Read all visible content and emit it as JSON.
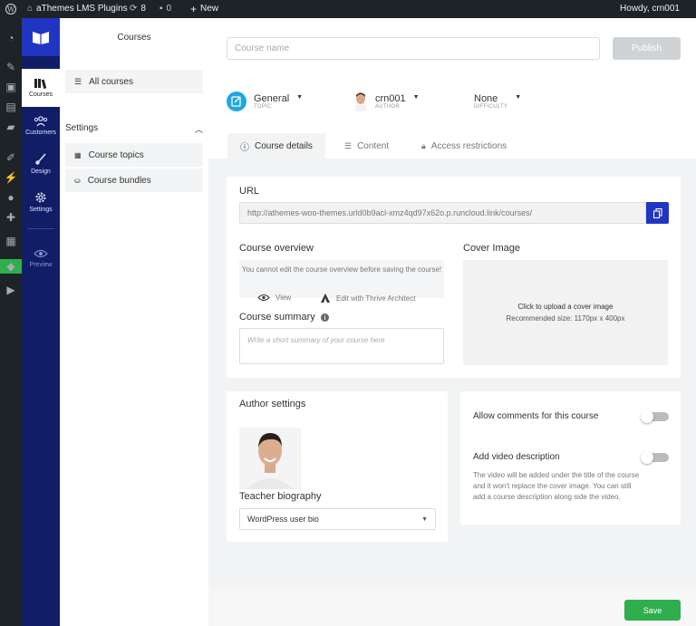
{
  "adminbar": {
    "site_name": "aThemes LMS Plugins",
    "updates_count": "8",
    "comments_count": "0",
    "new_label": "New",
    "greeting": "Howdy, crn001"
  },
  "rail": {
    "items": [
      {
        "label": "Courses",
        "icon": "books-icon"
      },
      {
        "label": "Customers",
        "icon": "users-icon"
      },
      {
        "label": "Design",
        "icon": "brush-icon"
      },
      {
        "label": "Settings",
        "icon": "gear-icon"
      },
      {
        "label": "Preview",
        "icon": "eye-icon"
      }
    ]
  },
  "sidebar": {
    "title": "Courses",
    "all_courses": "All courses",
    "settings_heading": "Settings",
    "course_topics": "Course topics",
    "course_bundles": "Course bundles"
  },
  "header": {
    "course_name_placeholder": "Course name",
    "publish_label": "Publish",
    "topic_value": "General",
    "topic_caption": "TOPIC",
    "author_value": "crn001",
    "author_caption": "AUTHOR",
    "difficulty_value": "None",
    "difficulty_caption": "DIFFICULTY"
  },
  "tabs": {
    "course_details": "Course details",
    "content": "Content",
    "access_restrictions": "Access restrictions"
  },
  "details": {
    "url_label": "URL",
    "url_value": "http://athemes-woo-themes.urld0b9acl-xmz4qd97x62o.p.runcloud.link/courses/",
    "overview_label": "Course overview",
    "overview_notice": "You cannot edit the course overview before saving the course!",
    "view_label": "View",
    "edit_label": "Edit with Thrive Architect",
    "summary_label": "Course summary",
    "summary_placeholder": "Write a short summary of your course here",
    "cover_label": "Cover Image",
    "cover_upload": "Click to upload a cover image",
    "cover_size": "Recommended size: 1170px x 400px"
  },
  "author": {
    "heading": "Author settings",
    "bio_label": "Teacher biography",
    "bio_select": "WordPress user bio"
  },
  "options": {
    "allow_comments": "Allow comments for this course",
    "allow_comments_on": false,
    "video_desc": "Add video description",
    "video_desc_on": false,
    "video_help": "The video will be added under the title of the course and it won't replace the cover image. You can still add a course description along side the video."
  },
  "footer": {
    "save_label": "Save"
  },
  "colors": {
    "navy": "#111e66",
    "brand_blue": "#2135c3",
    "topic_cyan": "#1fa7e1",
    "save_green": "#2fae4e"
  }
}
